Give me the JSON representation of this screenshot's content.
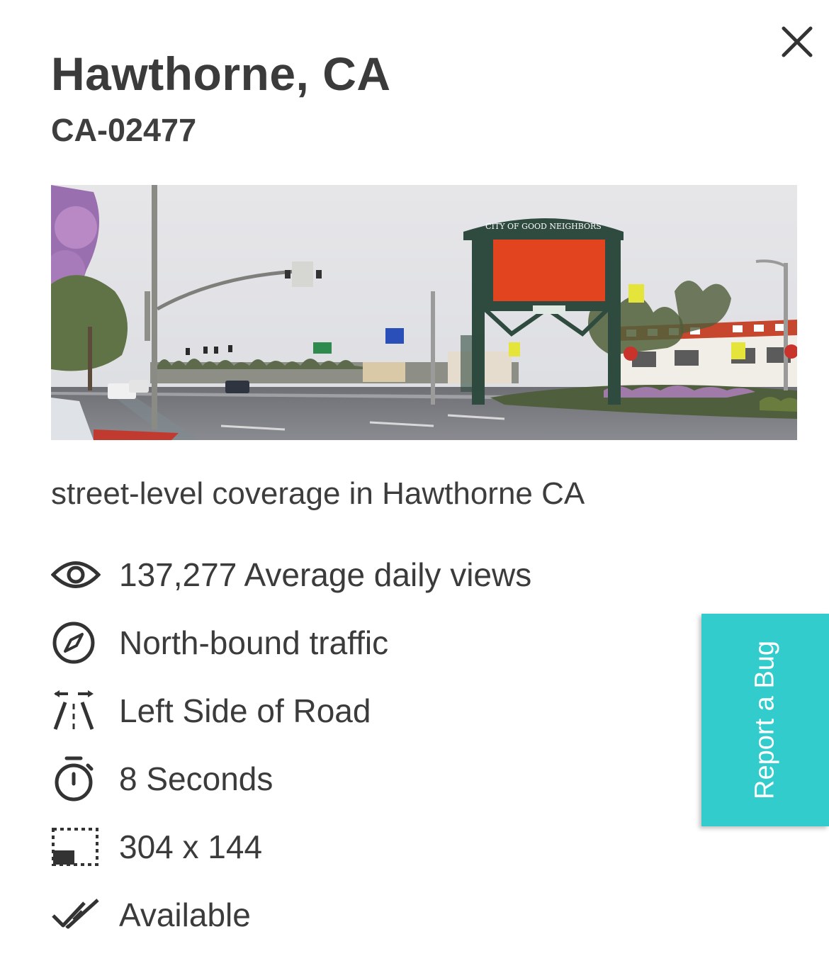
{
  "header": {
    "title": "Hawthorne, CA",
    "code": "CA-02477"
  },
  "photo": {
    "sign_text": "CITY OF GOOD NEIGHBORS",
    "placeholder_color": "#e2441f"
  },
  "description": "street-level coverage in Hawthorne CA",
  "stats": {
    "views": {
      "icon": "eye-icon",
      "text": "137,277 Average daily views"
    },
    "direction": {
      "icon": "compass-icon",
      "text": "North-bound traffic"
    },
    "side": {
      "icon": "road-side-icon",
      "text": "Left Side of Road"
    },
    "duration": {
      "icon": "stopwatch-icon",
      "text": "8 Seconds"
    },
    "size": {
      "icon": "dimensions-icon",
      "text": "304 x 144"
    },
    "availability": {
      "icon": "double-check-icon",
      "text": "Available"
    }
  },
  "report_bug": {
    "label": "Report a Bug",
    "color": "#33cccc"
  },
  "colors": {
    "text": "#3b3b3b",
    "accent": "#33cccc",
    "billboard": "#e2441f"
  }
}
